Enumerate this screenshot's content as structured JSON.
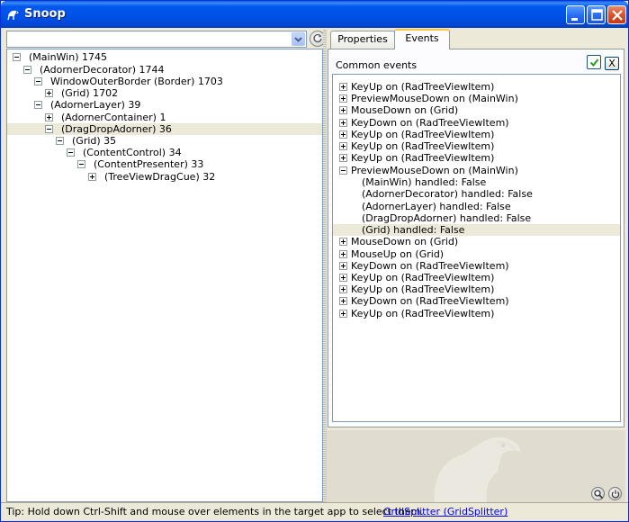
{
  "window": {
    "title": "Snoop"
  },
  "tree": {
    "items": [
      {
        "label": "(MainWin) 1745",
        "state": "expanded",
        "depth": 0
      },
      {
        "label": "(AdornerDecorator) 1744",
        "state": "expanded",
        "depth": 1
      },
      {
        "label": "WindowOuterBorder (Border) 1703",
        "state": "expanded",
        "depth": 2
      },
      {
        "label": "(Grid) 1702",
        "state": "collapsed",
        "depth": 3
      },
      {
        "label": "(AdornerLayer) 39",
        "state": "expanded",
        "depth": 2
      },
      {
        "label": "(AdornerContainer) 1",
        "state": "collapsed",
        "depth": 3
      },
      {
        "label": "(DragDropAdorner) 36",
        "state": "expanded",
        "depth": 3,
        "selected": true
      },
      {
        "label": "(Grid) 35",
        "state": "expanded",
        "depth": 4
      },
      {
        "label": "(ContentControl) 34",
        "state": "expanded",
        "depth": 5
      },
      {
        "label": "(ContentPresenter) 33",
        "state": "expanded",
        "depth": 6
      },
      {
        "label": "(TreeViewDragCue) 32",
        "state": "collapsed",
        "depth": 7
      }
    ]
  },
  "tabs": [
    {
      "label": "Properties",
      "active": false
    },
    {
      "label": "Events",
      "active": true
    }
  ],
  "events_panel": {
    "filter_label": "Common events",
    "clear_label": "X",
    "items": [
      {
        "label": "KeyUp on (RadTreeViewItem)",
        "type": "event",
        "state": "collapsed"
      },
      {
        "label": "PreviewMouseDown on (MainWin)",
        "type": "event",
        "state": "collapsed"
      },
      {
        "label": "MouseDown on (Grid)",
        "type": "event",
        "state": "collapsed"
      },
      {
        "label": "KeyDown on (RadTreeViewItem)",
        "type": "event",
        "state": "collapsed"
      },
      {
        "label": "KeyUp on (RadTreeViewItem)",
        "type": "event",
        "state": "collapsed"
      },
      {
        "label": "KeyUp on (RadTreeViewItem)",
        "type": "event",
        "state": "collapsed"
      },
      {
        "label": "KeyUp on (RadTreeViewItem)",
        "type": "event",
        "state": "collapsed"
      },
      {
        "label": "PreviewMouseDown on (MainWin)",
        "type": "event",
        "state": "expanded"
      },
      {
        "label": "(MainWin) handled: False",
        "type": "detail"
      },
      {
        "label": "(AdornerDecorator) handled: False",
        "type": "detail"
      },
      {
        "label": "(AdornerLayer) handled: False",
        "type": "detail"
      },
      {
        "label": "(DragDropAdorner) handled: False",
        "type": "detail"
      },
      {
        "label": "(Grid) handled: False",
        "type": "detail",
        "selected": true
      },
      {
        "label": "MouseDown on (Grid)",
        "type": "event",
        "state": "collapsed"
      },
      {
        "label": "MouseUp on (Grid)",
        "type": "event",
        "state": "collapsed"
      },
      {
        "label": "KeyDown on (RadTreeViewItem)",
        "type": "event",
        "state": "collapsed"
      },
      {
        "label": "KeyUp on (RadTreeViewItem)",
        "type": "event",
        "state": "collapsed"
      },
      {
        "label": "KeyUp on (RadTreeViewItem)",
        "type": "event",
        "state": "collapsed"
      },
      {
        "label": "KeyDown on (RadTreeViewItem)",
        "type": "event",
        "state": "collapsed"
      },
      {
        "label": "KeyUp on (RadTreeViewItem)",
        "type": "event",
        "state": "collapsed"
      }
    ]
  },
  "statusbar": {
    "tip": "Tip: Hold down Ctrl-Shift and mouse over elements in the target app to select them.",
    "link": "GridSplitter (GridSplitter)"
  },
  "icons": {
    "title": "snoop-icon",
    "combo": "chevron-down-icon",
    "refresh": "refresh-icon",
    "filter": "checkmark-icon",
    "zoom": "magnifier-icon",
    "power": "power-icon"
  },
  "colors": {
    "titlebar": "#0054e3",
    "selection": "#ece9d8",
    "link": "#0000ee",
    "active_tab_accent": "#ffc83c"
  }
}
